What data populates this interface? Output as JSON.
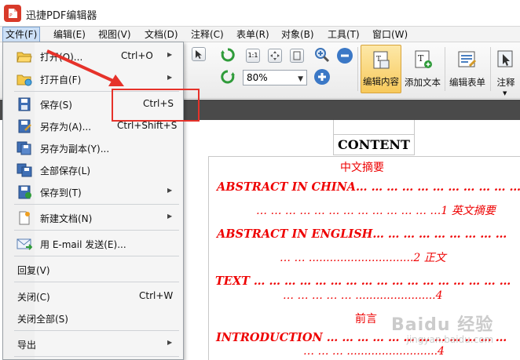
{
  "window": {
    "title": "迅捷PDF编辑器"
  },
  "menubar": [
    {
      "label": "文件(F)",
      "active": true
    },
    {
      "label": "编辑(E)"
    },
    {
      "label": "视图(V)"
    },
    {
      "label": "文档(D)"
    },
    {
      "label": "注释(C)"
    },
    {
      "label": "表单(R)"
    },
    {
      "label": "对象(B)"
    },
    {
      "label": "工具(T)"
    },
    {
      "label": "窗口(W)"
    }
  ],
  "toolbar": {
    "zoom_value": "80%",
    "edit_content_label": "编辑内容",
    "add_text_label": "添加文本",
    "edit_form_label": "编辑表单",
    "annotate_label": "注释"
  },
  "file_menu": {
    "items": [
      {
        "label": "打开(O)...",
        "shortcut": "Ctrl+O",
        "icon": "folder-open-icon",
        "submenu": true
      },
      {
        "label": "打开自(F)",
        "shortcut": "",
        "icon": "folder-globe-icon",
        "submenu": true
      },
      {
        "label": "保存(S)",
        "shortcut": "Ctrl+S",
        "icon": "floppy-disk-icon"
      },
      {
        "label": "另存为(A)...",
        "shortcut": "Ctrl+Shift+S",
        "icon": "save-as-icon"
      },
      {
        "label": "另存为副本(Y)...",
        "shortcut": "",
        "icon": "save-copy-icon"
      },
      {
        "label": "全部保存(L)",
        "shortcut": "",
        "icon": "save-all-icon"
      },
      {
        "label": "保存到(T)",
        "shortcut": "",
        "icon": "save-to-icon",
        "submenu": true
      },
      {
        "label": "新建文档(N)",
        "shortcut": "",
        "icon": "new-document-icon",
        "submenu": true
      },
      {
        "label": "用 E-mail 发送(E)...",
        "shortcut": "",
        "icon": "email-icon"
      },
      {
        "label": "回复(V)",
        "shortcut": ""
      },
      {
        "label": "关闭(C)",
        "shortcut": "Ctrl+W"
      },
      {
        "label": "关闭全部(S)",
        "shortcut": ""
      },
      {
        "label": "导出",
        "shortcut": "",
        "submenu": true
      }
    ]
  },
  "document": {
    "heading": "CONTENT",
    "toc": [
      "中文摘要",
      "ABSTRACT IN CHINA… … … … … … … … … … …",
      "… … … … … … … … … … … … …1 英文摘要",
      "ABSTRACT IN ENGLISH… … … … … … … … …",
      "… … ..............................2 正文",
      "TEXT … … … … … … … … … … … … … … … … …",
      "… … … … … .......................4",
      "前言",
      "INTRODUCTION … … … … … … … … … … … …",
      "… … … ..........................4"
    ]
  },
  "watermark": {
    "brand": "Baidu 经验",
    "url": "jingyan.baidu.com"
  },
  "colors": {
    "accent": "#e6322a",
    "toc_text": "#ee0000",
    "menu_highlight": "#cce0f7"
  }
}
